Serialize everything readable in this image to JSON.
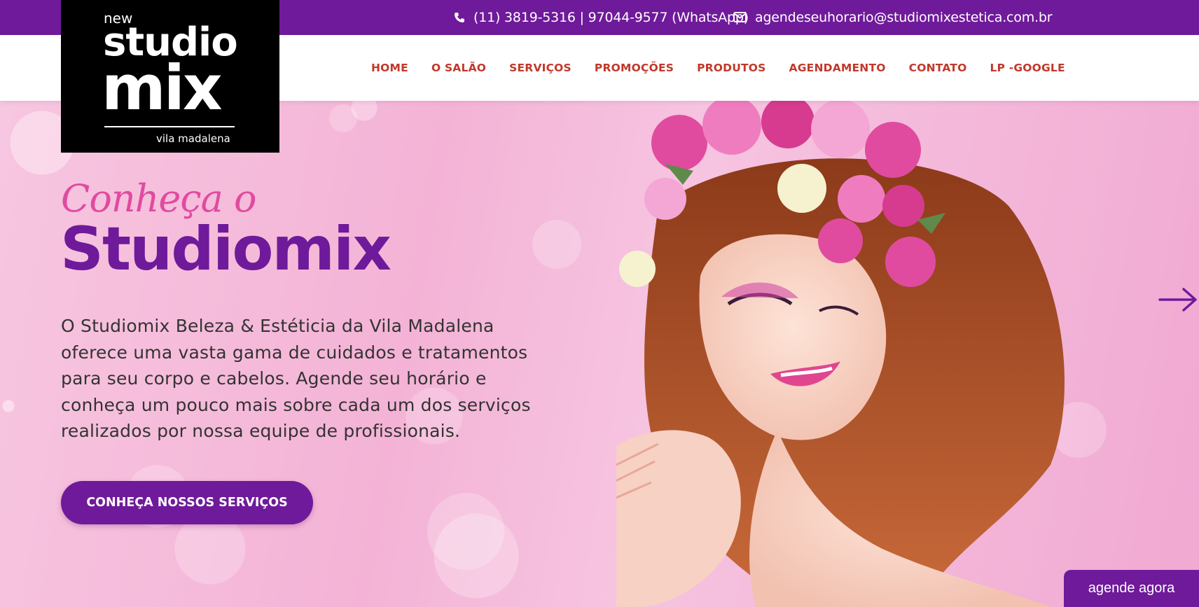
{
  "topbar": {
    "phone": "(11) 3819-5316 | 97044-9577 (WhatsApp)",
    "email": "agendeseuhorario@studiomixestetica.com.br",
    "phone_icon": "phone-icon",
    "email_icon": "envelope-icon"
  },
  "logo": {
    "new": "new",
    "studio": "studio",
    "mix": "mix",
    "subtitle": "vila madalena"
  },
  "nav": {
    "items": [
      {
        "label": "HOME"
      },
      {
        "label": "O SALÃO"
      },
      {
        "label": "SERVIÇOS"
      },
      {
        "label": "PROMOÇÕES"
      },
      {
        "label": "PRODUTOS"
      },
      {
        "label": "AGENDAMENTO"
      },
      {
        "label": "CONTATO"
      },
      {
        "label": "LP -GOOGLE"
      }
    ]
  },
  "hero": {
    "script": "Conheça o",
    "title": "Studiomix",
    "text": "O Studiomix Beleza & Estéticia da Vila Madalena oferece uma vasta gama de cuidados e tratamentos para seu corpo e cabelos. Agende seu horário e conheça um pouco mais sobre cada um dos serviços realizados por nossa equipe de profissionais.",
    "button": "CONHEÇA NOSSOS SERVIÇOS",
    "next_icon": "arrow-right-icon"
  },
  "floating": {
    "agende": "agende agora"
  },
  "colors": {
    "brand_purple": "#6f1a9a",
    "nav_red": "#c0392b",
    "script_pink": "#e04b9f"
  }
}
